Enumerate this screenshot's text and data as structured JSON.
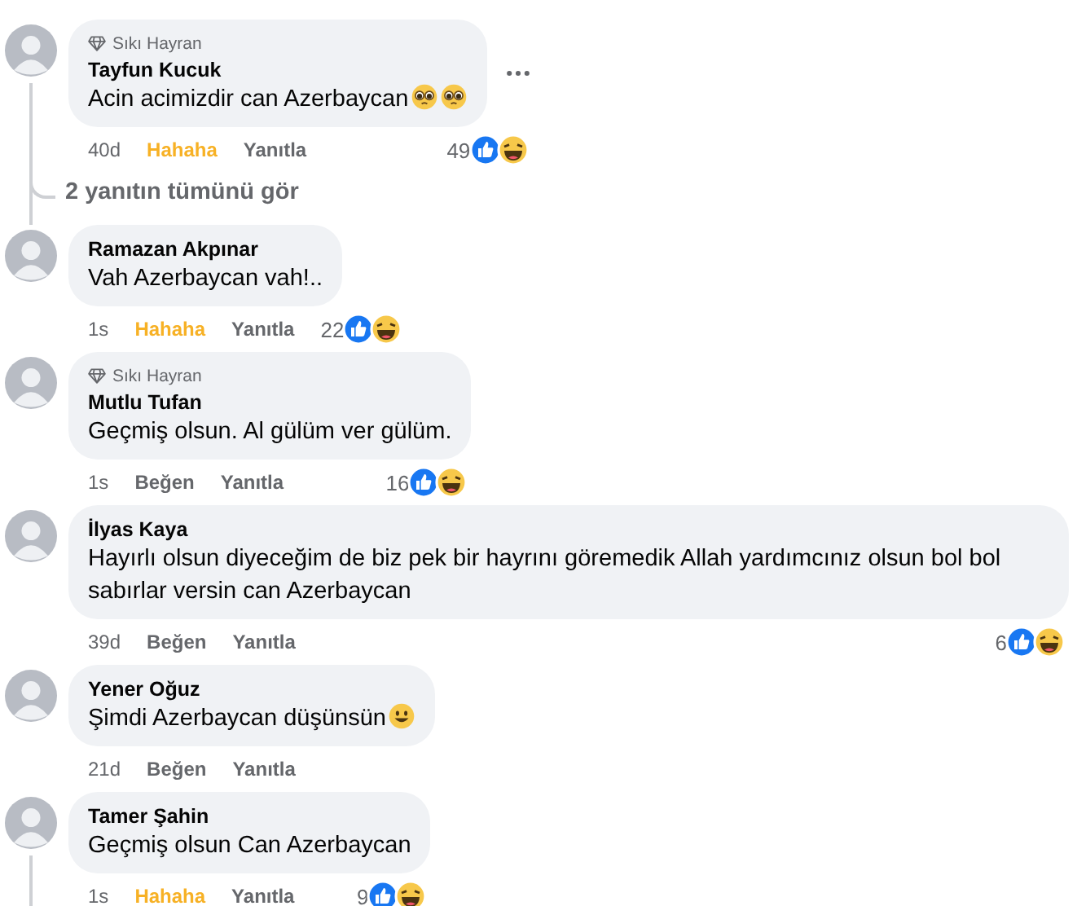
{
  "comments": [
    {
      "author": "Tayfun Kucuk",
      "badge": "Sıkı Hayran",
      "text": "Acin acimizdir can Azerbaycan",
      "emojis": [
        {
          "kind": "pleading"
        },
        {
          "kind": "pleading"
        }
      ],
      "time": "40d",
      "reaction_label": "Hahaha",
      "reacted": true,
      "reply_label": "Yanıtla",
      "reaction_count": "49",
      "reactions": [
        {
          "kind": "like"
        },
        {
          "kind": "haha"
        }
      ],
      "has_menu": true,
      "thread": true,
      "replies_link": "2 yanıtın tümünü gör"
    },
    {
      "author": "Ramazan Akpınar",
      "text": "Vah Azerbaycan vah!..",
      "time": "1s",
      "reaction_label": "Hahaha",
      "reacted": true,
      "reply_label": "Yanıtla",
      "reaction_count": "22",
      "reactions": [
        {
          "kind": "like"
        },
        {
          "kind": "haha"
        }
      ],
      "has_menu": false,
      "thread": false
    },
    {
      "author": "Mutlu Tufan",
      "badge": "Sıkı Hayran",
      "text": "Geçmiş olsun. Al gülüm ver gülüm.",
      "time": "1s",
      "reaction_label": "Beğen",
      "reacted": false,
      "reply_label": "Yanıtla",
      "reaction_count": "16",
      "reactions": [
        {
          "kind": "like"
        },
        {
          "kind": "haha"
        }
      ],
      "has_menu": false,
      "thread": false
    },
    {
      "author": "İlyas Kaya",
      "text": "Hayırlı olsun diyeceğim de biz pek bir hayrını göremedik Allah yardımcınız olsun bol bol sabırlar versin can Azerbaycan",
      "time": "39d",
      "reaction_label": "Beğen",
      "reacted": false,
      "reply_label": "Yanıtla",
      "reaction_count": "6",
      "reactions": [
        {
          "kind": "like"
        },
        {
          "kind": "haha"
        }
      ],
      "has_menu": false,
      "thread": false
    },
    {
      "author": "Yener Oğuz",
      "text": "Şimdi Azerbaycan düşünsün",
      "emojis": [
        {
          "kind": "smile"
        }
      ],
      "time": "21d",
      "reaction_label": "Beğen",
      "reacted": false,
      "reply_label": "Yanıtla",
      "has_menu": false,
      "thread": false
    },
    {
      "author": "Tamer Şahin",
      "text": "Geçmiş olsun Can Azerbaycan",
      "time": "1s",
      "reaction_label": "Hahaha",
      "reacted": true,
      "reply_label": "Yanıtla",
      "reaction_count": "9",
      "reactions": [
        {
          "kind": "like"
        },
        {
          "kind": "haha"
        }
      ],
      "has_menu": false,
      "thread": true
    }
  ]
}
